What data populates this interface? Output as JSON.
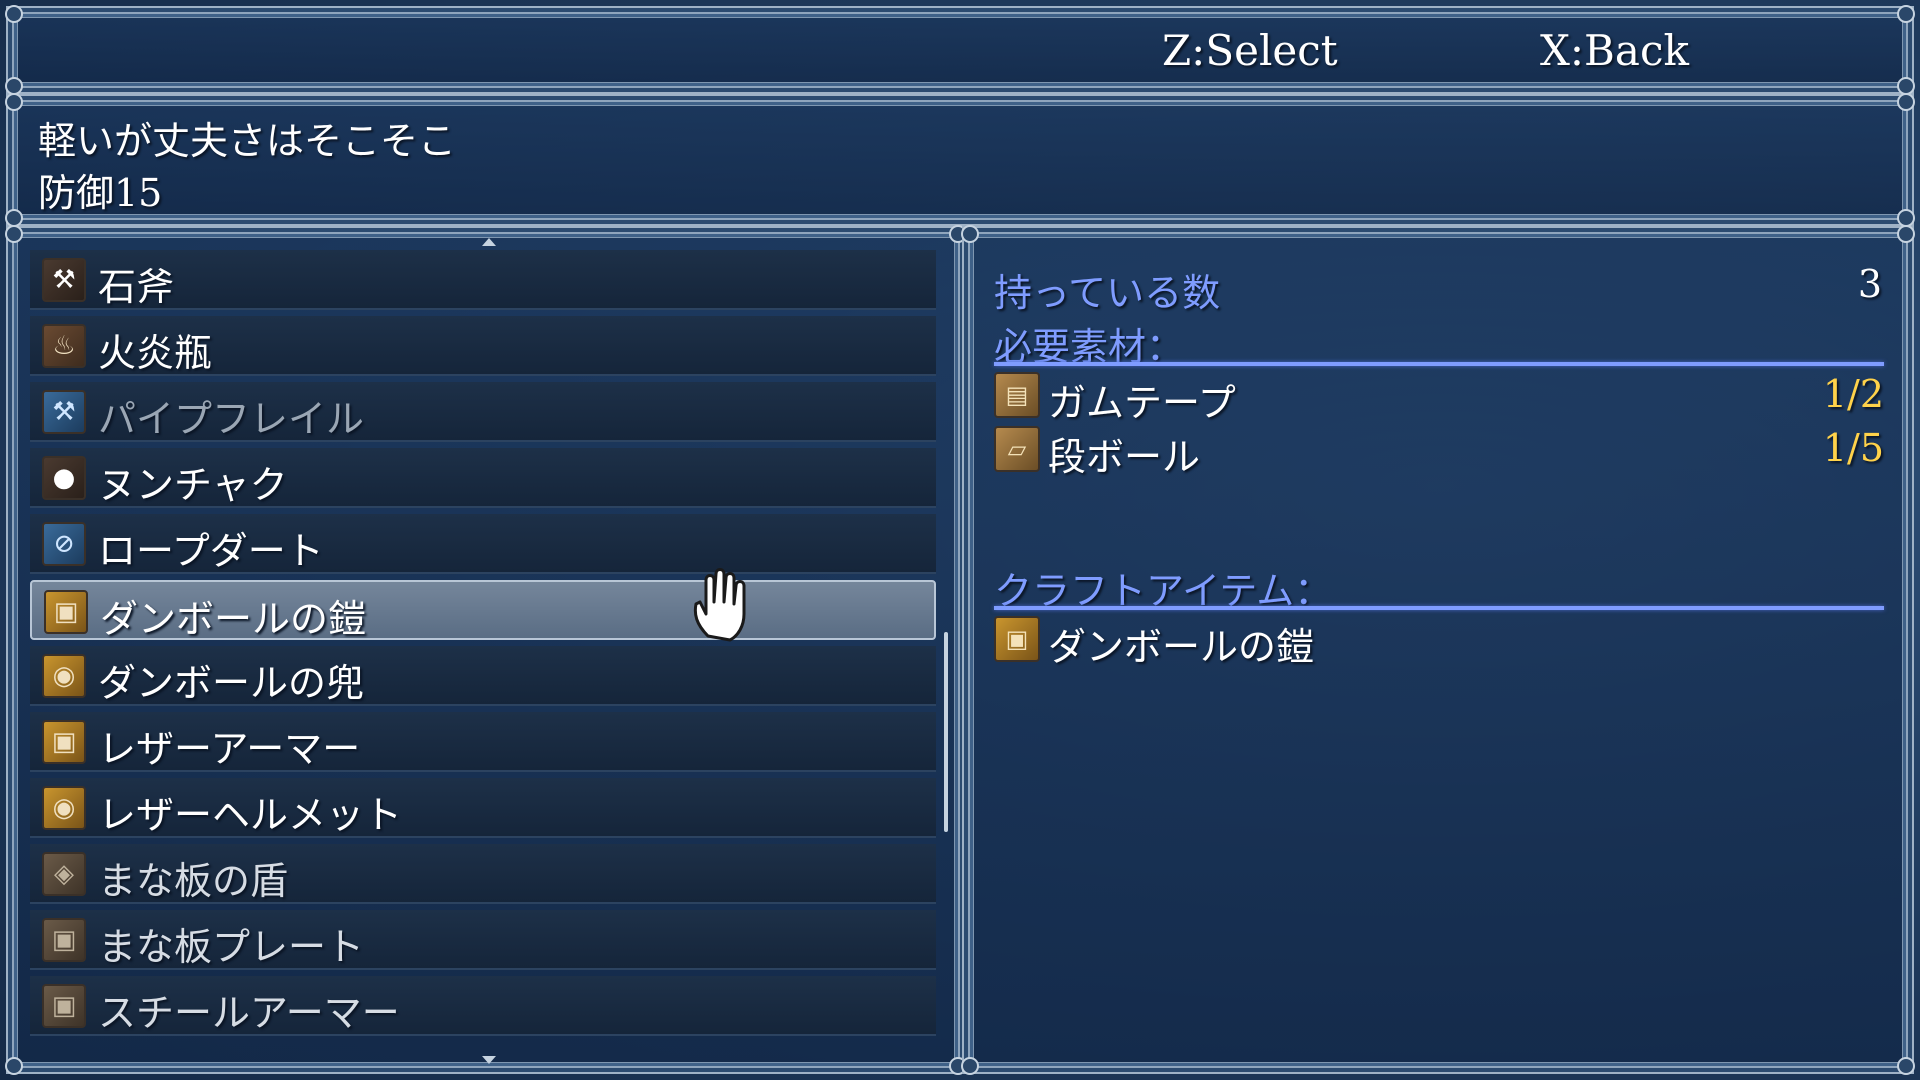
{
  "controls": {
    "select": "Z:Select",
    "back": "X:Back"
  },
  "description": {
    "line1": "軽いが丈夫さはそこそこ",
    "line2": "防御15"
  },
  "list": {
    "items": [
      {
        "label": "石斧",
        "icon": "stone-axe-icon",
        "state": "normal"
      },
      {
        "label": "火炎瓶",
        "icon": "fire-bottle-icon",
        "state": "normal"
      },
      {
        "label": "パイプフレイル",
        "icon": "pipe-flail-icon",
        "state": "disabled"
      },
      {
        "label": "ヌンチャク",
        "icon": "nunchaku-icon",
        "state": "normal"
      },
      {
        "label": "ロープダート",
        "icon": "rope-dart-icon",
        "state": "normal"
      },
      {
        "label": "ダンボールの鎧",
        "icon": "cardboard-armor-icon",
        "state": "selected"
      },
      {
        "label": "ダンボールの兜",
        "icon": "cardboard-helmet-icon",
        "state": "normal"
      },
      {
        "label": "レザーアーマー",
        "icon": "leather-armor-icon",
        "state": "normal"
      },
      {
        "label": "レザーヘルメット",
        "icon": "leather-helmet-icon",
        "state": "normal"
      },
      {
        "label": "まな板の盾",
        "icon": "cutting-board-shield-icon",
        "state": "dim"
      },
      {
        "label": "まな板プレート",
        "icon": "cutting-board-plate-icon",
        "state": "dim"
      },
      {
        "label": "スチールアーマー",
        "icon": "steel-armor-icon",
        "state": "dim"
      }
    ]
  },
  "detail": {
    "owned_label": "持っている数",
    "owned_value": "3",
    "materials_label": "必要素材：",
    "materials": [
      {
        "name": "ガムテープ",
        "count": "1/2",
        "icon": "gum-tape-icon"
      },
      {
        "name": "段ボール",
        "count": "1/5",
        "icon": "cardboard-icon"
      }
    ],
    "craft_label": "クラフトアイテム：",
    "craft_item": {
      "name": "ダンボールの鎧",
      "icon": "cardboard-armor-icon"
    }
  },
  "colors": {
    "accent_label": "#7f9cff",
    "count_yellow": "#ffd24a",
    "selected_row": "#6a7b90"
  }
}
